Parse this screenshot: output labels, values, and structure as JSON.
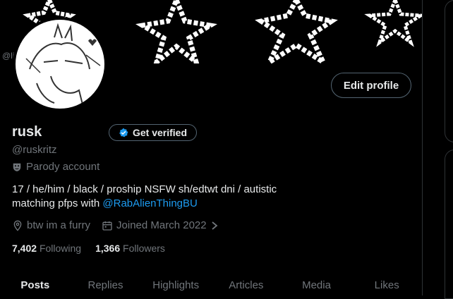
{
  "banner": {
    "handle_peek": "@li"
  },
  "profile": {
    "edit_label": "Edit profile",
    "name": "rusk",
    "verify_label": "Get verified",
    "handle": "@ruskritz",
    "parody_label": "Parody account",
    "bio_line1": "17 / he/him / black / proship NSFW  sh/edtwt dni / autistic",
    "bio_line2_prefix": "matching pfps with ",
    "bio_mention": "@RabAlienThingBU",
    "location": "btw im a furry",
    "joined": "Joined March 2022",
    "following_count": "7,402",
    "following_label": "Following",
    "followers_count": "1,366",
    "followers_label": "Followers"
  },
  "tabs": [
    {
      "label": "Posts",
      "active": true
    },
    {
      "label": "Replies",
      "active": false
    },
    {
      "label": "Highlights",
      "active": false
    },
    {
      "label": "Articles",
      "active": false
    },
    {
      "label": "Media",
      "active": false
    },
    {
      "label": "Likes",
      "active": false
    }
  ],
  "colors": {
    "accent": "#1d9bf0",
    "background": "#000000",
    "muted": "#71767b"
  }
}
